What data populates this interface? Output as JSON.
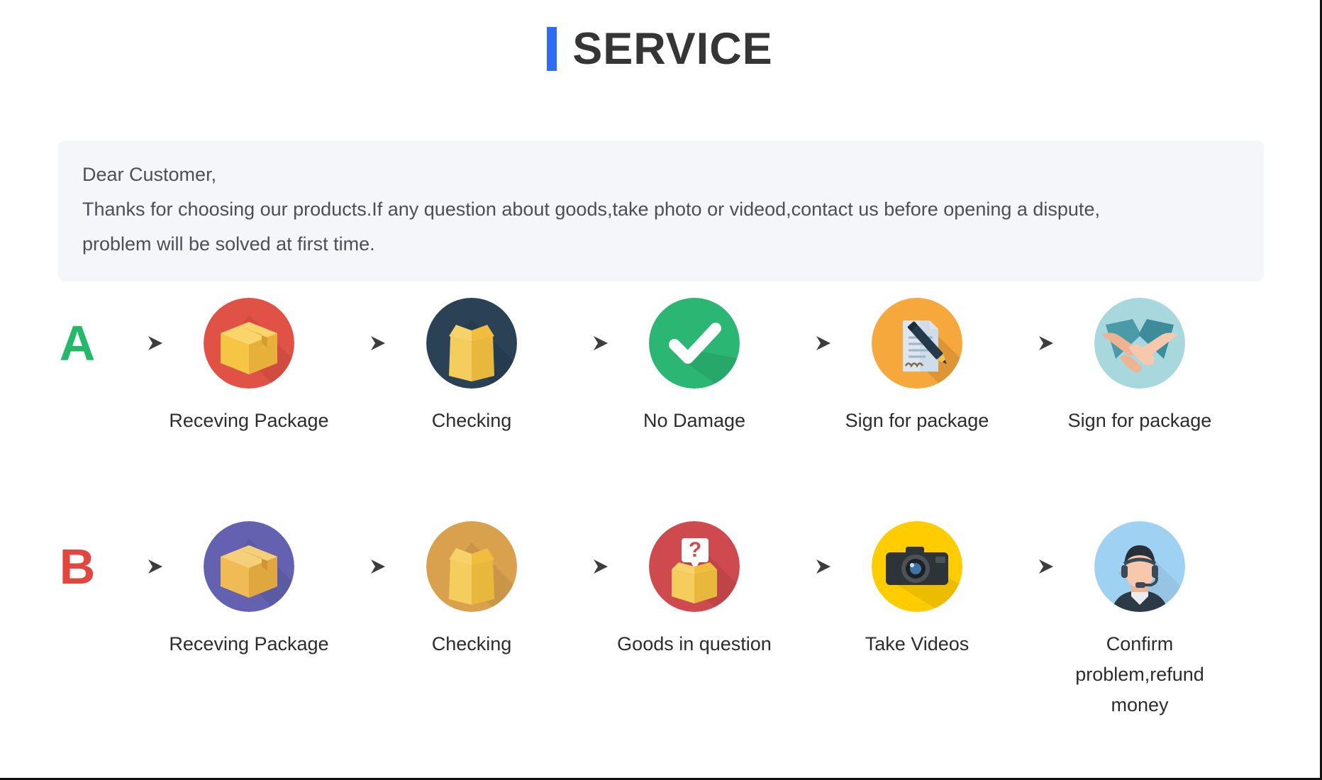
{
  "header": {
    "accent_color": "#2f6bf5",
    "title": "SERVICE",
    "accent_bar_icon": "vertical-bar-icon"
  },
  "note": {
    "background_color": "#f4f6fa",
    "lines": [
      "Dear Customer,",
      "Thanks for choosing our products.If any question about goods,take photo or videod,contact us before opening a dispute,",
      "problem will be solved at first time."
    ]
  },
  "flows": [
    {
      "badge": "A",
      "badge_color": "#25b86a",
      "steps": [
        {
          "label": "Receving Package",
          "icon": "package-box-icon",
          "circle_color": "#e05246"
        },
        {
          "label": "Checking",
          "icon": "open-box-icon",
          "circle_color": "#2b4256"
        },
        {
          "label": "No Damage",
          "icon": "check-mark-icon",
          "circle_color": "#2bb673"
        },
        {
          "label": "Sign for package",
          "icon": "document-pen-icon",
          "circle_color": "#f7a83c"
        },
        {
          "label": "Sign for package",
          "icon": "handshake-icon",
          "circle_color": "#a8d8dd"
        }
      ]
    },
    {
      "badge": "B",
      "badge_color": "#e2463f",
      "steps": [
        {
          "label": "Receving Package",
          "icon": "package-box-icon",
          "circle_color": "#6361b0"
        },
        {
          "label": "Checking",
          "icon": "open-box-icon",
          "circle_color": "#d9a14e"
        },
        {
          "label": "Goods in question",
          "icon": "question-box-icon",
          "circle_color": "#cf4a4f"
        },
        {
          "label": "Take Videos",
          "icon": "camera-icon",
          "circle_color": "#ffcc00"
        },
        {
          "label": "Confirm problem,refund money",
          "icon": "support-agent-icon",
          "circle_color": "#9fd2f2"
        }
      ]
    }
  ],
  "arrow_icon": "arrow-right-icon"
}
